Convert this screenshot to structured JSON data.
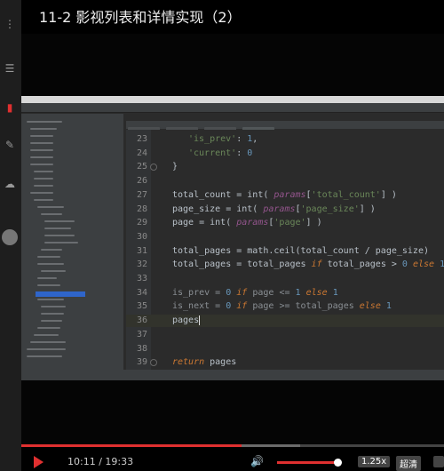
{
  "title": "11-2 影视列表和详情实现（2）",
  "code_lines": [
    {
      "num": "23",
      "html_id": "l23"
    },
    {
      "num": "24",
      "html_id": "l24"
    },
    {
      "num": "25",
      "html_id": "l25"
    },
    {
      "num": "26",
      "html_id": "l26"
    },
    {
      "num": "27",
      "html_id": "l27"
    },
    {
      "num": "28",
      "html_id": "l28"
    },
    {
      "num": "29",
      "html_id": "l29"
    },
    {
      "num": "30",
      "html_id": "l30"
    },
    {
      "num": "31",
      "html_id": "l31"
    },
    {
      "num": "32",
      "html_id": "l32"
    },
    {
      "num": "33",
      "html_id": "l33"
    },
    {
      "num": "34",
      "html_id": "l34"
    },
    {
      "num": "35",
      "html_id": "l35"
    },
    {
      "num": "36",
      "html_id": "l36"
    },
    {
      "num": "37",
      "html_id": "l37"
    },
    {
      "num": "38",
      "html_id": "l38"
    },
    {
      "num": "39",
      "html_id": "l39"
    }
  ],
  "code": {
    "l23": [
      "'is_prev'",
      ": ",
      "1",
      ","
    ],
    "l24": [
      "'current'",
      ": ",
      "0"
    ],
    "l25": [
      "}"
    ],
    "l27": [
      "total_count = int( ",
      "params",
      "[",
      "'total_count'",
      "] )"
    ],
    "l28": [
      "page_size = int( ",
      "params",
      "[",
      "'page_size'",
      "] )"
    ],
    "l29": [
      "page = int( ",
      "params",
      "[",
      "'page'",
      "] )"
    ],
    "l31": [
      "total_pages = math.ceil(total_count / page_size)"
    ],
    "l32": [
      "total_pages = total_pages ",
      "if",
      " total_pages > ",
      "0",
      " ",
      "else",
      " ",
      "1"
    ],
    "l34": [
      "is_prev = ",
      "0",
      " ",
      "if",
      " page <= ",
      "1",
      " ",
      "else",
      " ",
      "1"
    ],
    "l35": [
      "is_next = ",
      "0",
      " ",
      "if",
      " page >= total_pages ",
      "else",
      " ",
      "1"
    ],
    "l36": [
      "pages"
    ],
    "l39": [
      "return",
      " pages"
    ]
  },
  "player": {
    "current_time": "10:11",
    "separator": " / ",
    "duration": "19:33",
    "progress": 0.52,
    "buffered": 0.66,
    "volume": 0.95,
    "speed": "1.25x",
    "quality": "超清"
  },
  "colors": {
    "accent": "#e03030",
    "keyword": "#cc7832",
    "string": "#6a8759",
    "number": "#6897bb",
    "param": "#94558d"
  },
  "icons": [
    "menu-icon",
    "bookmark-icon",
    "pen-icon",
    "cloud-icon",
    "avatar",
    "play-icon",
    "volume-icon"
  ]
}
